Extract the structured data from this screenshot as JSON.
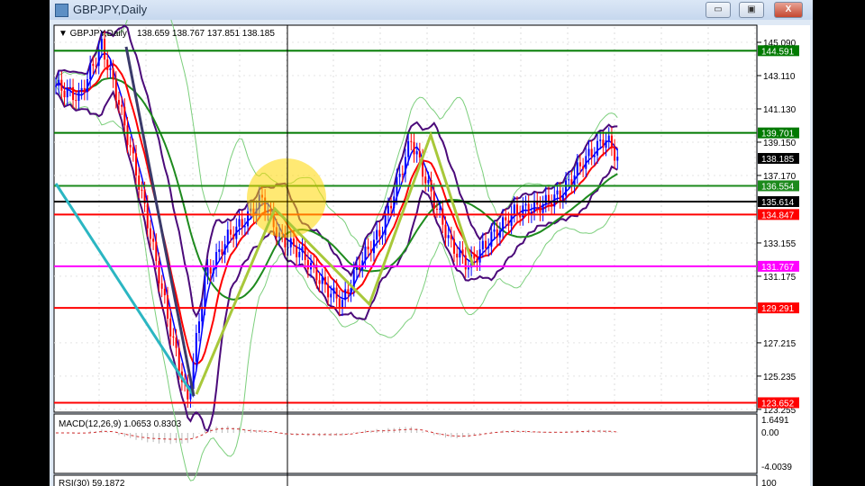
{
  "window": {
    "title": "GBPJPY,Daily",
    "minimize": "▭",
    "restore": "▣",
    "close": "X"
  },
  "chart_header": {
    "symbol": "GBPJPY,Daily",
    "ohlc": "138.659 138.767 137.851 138.185"
  },
  "price_axis": {
    "ticks": [
      "145.090",
      "143.110",
      "141.130",
      "139.150",
      "137.170",
      "133.155",
      "131.175",
      "127.215",
      "125.235",
      "123.255"
    ]
  },
  "levels": [
    {
      "price": "144.591",
      "color": "#007a00"
    },
    {
      "price": "139.701",
      "color": "#007a00"
    },
    {
      "price": "138.185",
      "color": "#000000"
    },
    {
      "price": "136.554",
      "color": "#1c8a1c"
    },
    {
      "price": "135.614",
      "color": "#000000"
    },
    {
      "price": "134.847",
      "color": "#ff0000"
    },
    {
      "price": "131.767",
      "color": "#ff00ff"
    },
    {
      "price": "129.291",
      "color": "#ff0000"
    },
    {
      "price": "123.652",
      "color": "#ff0000"
    }
  ],
  "macd": {
    "label": "MACD(12,26,9) 1.0653 0.8303",
    "ticks": [
      "1.6491",
      "0.00",
      "-4.0039"
    ]
  },
  "rsi": {
    "label": "RSI(30) 59.1872",
    "ticks": [
      "100"
    ]
  },
  "chart_data": {
    "type": "candlestick",
    "symbol": "GBPJPY",
    "timeframe": "Daily",
    "ylim": [
      123.0,
      145.3
    ],
    "price_path_keypoints": [
      [
        0,
        142.5
      ],
      [
        8,
        141.8
      ],
      [
        16,
        144.9
      ],
      [
        22,
        141.5
      ],
      [
        30,
        136
      ],
      [
        40,
        128
      ],
      [
        46,
        123.7
      ],
      [
        52,
        131
      ],
      [
        60,
        133.5
      ],
      [
        66,
        134.5
      ],
      [
        72,
        135.8
      ],
      [
        78,
        133.5
      ],
      [
        86,
        132.5
      ],
      [
        94,
        130.5
      ],
      [
        100,
        129.6
      ],
      [
        106,
        132
      ],
      [
        114,
        134
      ],
      [
        124,
        139.3
      ],
      [
        130,
        136.5
      ],
      [
        138,
        133
      ],
      [
        144,
        131.8
      ],
      [
        152,
        133.5
      ],
      [
        160,
        135
      ],
      [
        168,
        135.3
      ],
      [
        176,
        136
      ],
      [
        184,
        138
      ],
      [
        192,
        139.4
      ],
      [
        196,
        138.2
      ]
    ]
  }
}
